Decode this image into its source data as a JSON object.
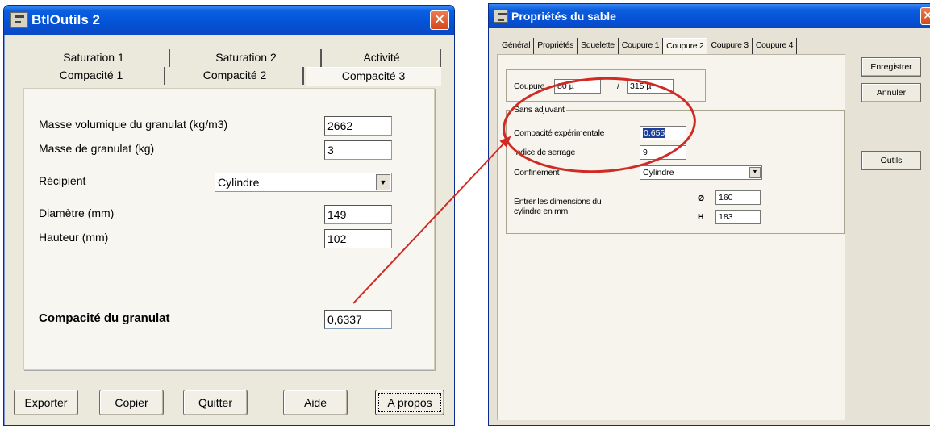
{
  "window1": {
    "title": "BtlOutils 2",
    "tabs_row1": [
      "Saturation 1",
      "Saturation 2",
      "Activité"
    ],
    "tabs_row2": [
      "Compacité 1",
      "Compacité 2",
      "Compacité 3"
    ],
    "active_tab": "Compacité 3",
    "fields": {
      "masse_volumique_label": "Masse volumique du granulat (kg/m3)",
      "masse_volumique_value": "2662",
      "masse_granulat_label": "Masse de granulat (kg)",
      "masse_granulat_value": "3",
      "recipient_label": "Récipient",
      "recipient_value": "Cylindre",
      "diametre_label": "Diamètre (mm)",
      "diametre_value": "149",
      "hauteur_label": "Hauteur (mm)",
      "hauteur_value": "102",
      "compacite_label": "Compacité du granulat",
      "compacite_value": "0,6337"
    },
    "buttons": [
      "Exporter",
      "Copier",
      "Quitter",
      "Aide",
      "A propos"
    ]
  },
  "window2": {
    "title": "Propriétés du sable",
    "tabs": [
      "Général",
      "Propriétés",
      "Squelette",
      "Coupure 1",
      "Coupure 2",
      "Coupure 3",
      "Coupure 4"
    ],
    "active_tab": "Coupure 2",
    "coupure_label": "Coupure",
    "coupure_from": "80 µ",
    "coupure_sep": "/",
    "coupure_to": "315 µ",
    "group_title": "Sans adjuvant",
    "compacite_exp_label": "Compacité expérimentale",
    "compacite_exp_value": "0.655",
    "indice_serrage_label": "Indice de serrage",
    "indice_serrage_value": "9",
    "confinement_label": "Confinement",
    "confinement_value": "Cylindre",
    "dimensions_label_line1": "Entrer les dimensions du",
    "dimensions_label_line2": "cylindre en mm",
    "diam_symbol": "Ø",
    "diam_value": "160",
    "h_symbol": "H",
    "h_value": "183",
    "btn_enregistrer": "Enregistrer",
    "btn_annuler": "Annuler",
    "btn_outils": "Outils"
  },
  "colors": {
    "titlebar": "#0452d6",
    "close": "#d4481a",
    "annotation": "#cf2b24",
    "selection": "#1c3f9a"
  }
}
